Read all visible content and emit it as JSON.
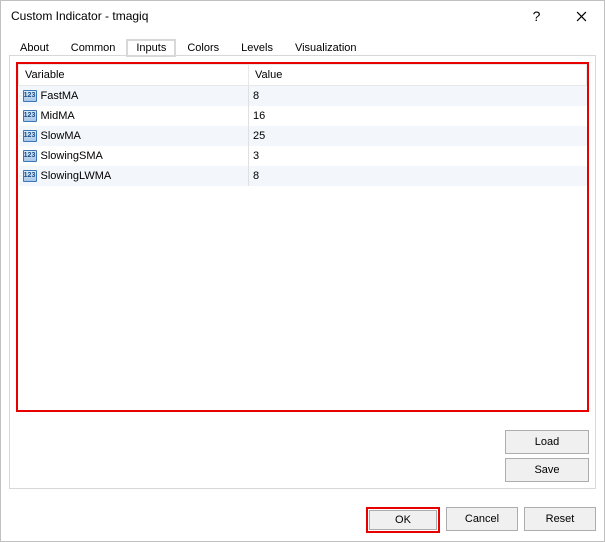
{
  "title": "Custom Indicator - tmagiq",
  "titlebar": {
    "help": "?",
    "close": "×"
  },
  "tabs": {
    "about": "About",
    "common": "Common",
    "inputs": "Inputs",
    "colors": "Colors",
    "levels": "Levels",
    "visualization": "Visualization"
  },
  "table": {
    "headers": {
      "variable": "Variable",
      "value": "Value"
    },
    "rows": [
      {
        "icon": "123",
        "name": "FastMA",
        "value": "8"
      },
      {
        "icon": "123",
        "name": "MidMA",
        "value": "16"
      },
      {
        "icon": "123",
        "name": "SlowMA",
        "value": "25"
      },
      {
        "icon": "123",
        "name": "SlowingSMA",
        "value": "3"
      },
      {
        "icon": "123",
        "name": "SlowingLWMA",
        "value": "8"
      }
    ]
  },
  "buttons": {
    "load": "Load",
    "save": "Save",
    "ok": "OK",
    "cancel": "Cancel",
    "reset": "Reset"
  }
}
